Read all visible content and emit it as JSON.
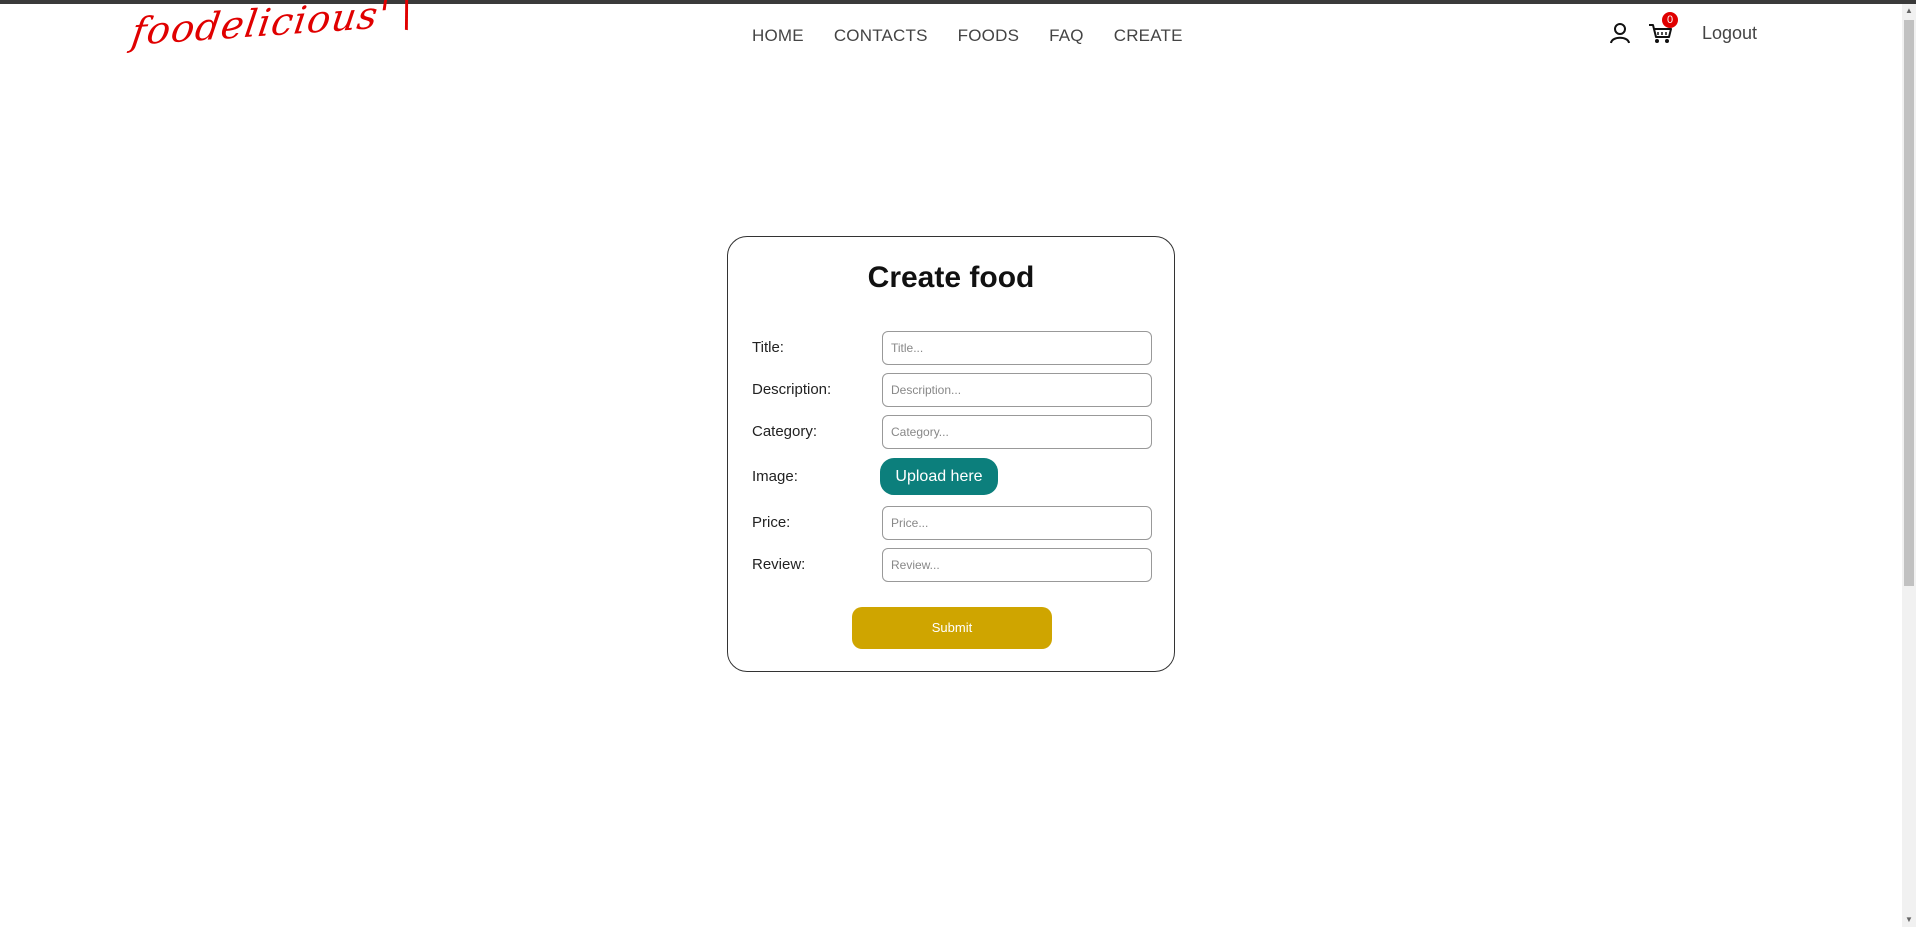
{
  "header": {
    "logo_text": "foodelicious'",
    "logo_mark": "\\",
    "nav": [
      "HOME",
      "CONTACTS",
      "FOODS",
      "FAQ",
      "CREATE"
    ],
    "cart_count": "0",
    "logout_label": "Logout",
    "icons": {
      "user": "user-icon",
      "cart": "cart-icon"
    }
  },
  "form": {
    "title": "Create food",
    "fields": [
      {
        "label": "Title:",
        "placeholder": "Title...",
        "value": ""
      },
      {
        "label": "Description:",
        "placeholder": "Description...",
        "value": ""
      },
      {
        "label": "Category:",
        "placeholder": "Category...",
        "value": ""
      },
      {
        "label": "Image:"
      },
      {
        "label": "Price:",
        "placeholder": "Price...",
        "value": ""
      },
      {
        "label": "Review:",
        "placeholder": "Review...",
        "value": ""
      }
    ],
    "upload_label": "Upload here",
    "submit_label": "Submit"
  },
  "colors": {
    "logo": "#e00000",
    "badge": "#e00000",
    "upload_button": "#0c7f7c",
    "submit_button": "#cfa500"
  }
}
